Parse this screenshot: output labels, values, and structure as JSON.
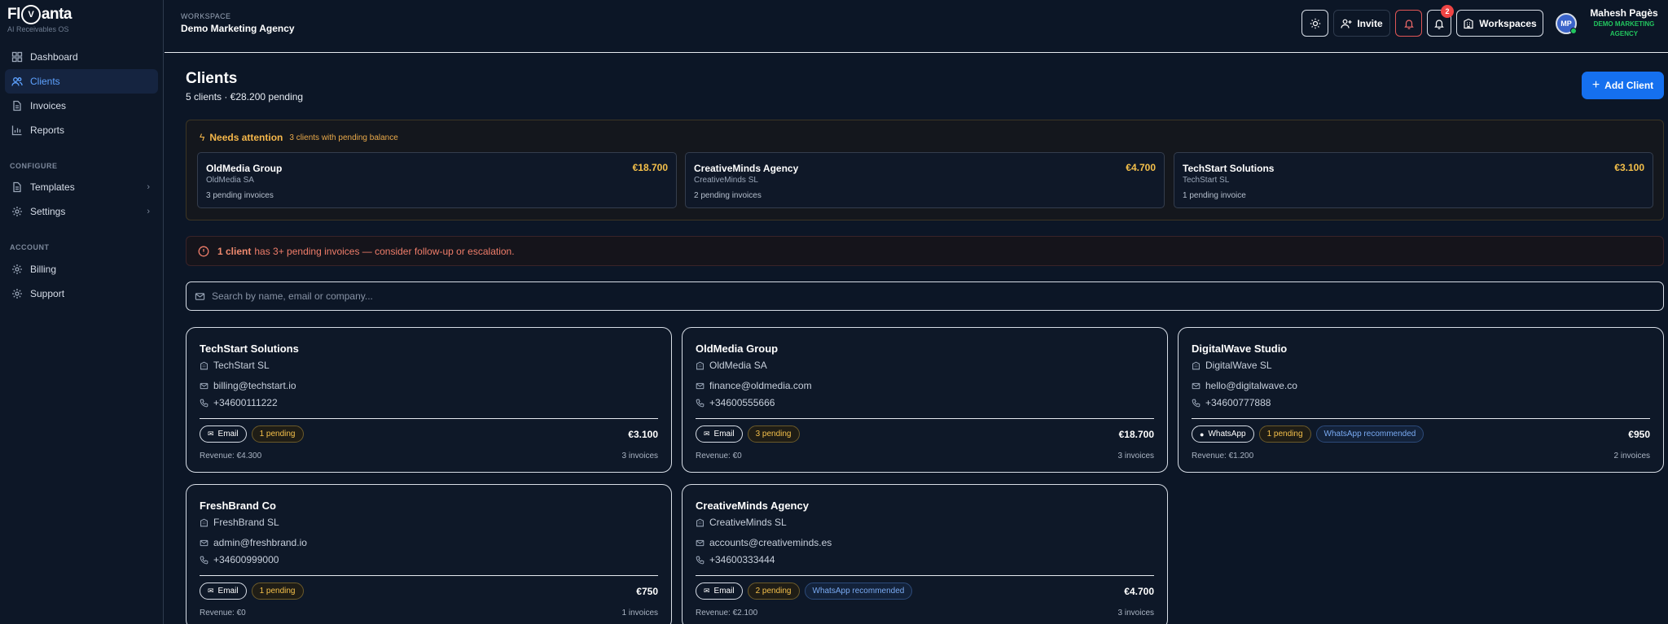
{
  "app": {
    "logo_left": "Fl",
    "logo_badge": "V",
    "logo_right": "anta",
    "subtitle": "AI Receivables OS"
  },
  "sidebar": {
    "main": [
      {
        "label": "Dashboard",
        "icon": "grid-icon",
        "active": false
      },
      {
        "label": "Clients",
        "icon": "users-icon",
        "active": true
      },
      {
        "label": "Invoices",
        "icon": "file-icon",
        "active": false
      },
      {
        "label": "Reports",
        "icon": "chart-icon",
        "active": false
      }
    ],
    "configure_title": "CONFIGURE",
    "configure": [
      {
        "label": "Templates",
        "icon": "file-icon",
        "chevron": "›"
      },
      {
        "label": "Settings",
        "icon": "gear-icon",
        "chevron": "›"
      }
    ],
    "account_title": "ACCOUNT",
    "account": [
      {
        "label": "Billing",
        "icon": "gear-icon"
      },
      {
        "label": "Support",
        "icon": "gear-icon"
      }
    ]
  },
  "header": {
    "workspace_label": "WORKSPACE",
    "workspace_name": "Demo Marketing Agency",
    "invite_label": "Invite",
    "notification_count": "2",
    "workspaces_label": "Workspaces",
    "user_initials": "MP",
    "user_name": "Mahesh Pagès",
    "user_workspace": "DEMO MARKETING AGENCY"
  },
  "page": {
    "title": "Clients",
    "subtitle": "5 clients · €28.200 pending",
    "add_button": "Add Client",
    "add_icon": "+"
  },
  "attention": {
    "title": "Needs attention",
    "subtitle": "3 clients with pending balance",
    "bolt_icon": "ϟ",
    "items": [
      {
        "name": "OldMedia Group",
        "amount": "€18.700",
        "company": "OldMedia SA",
        "pending": "3 pending invoices"
      },
      {
        "name": "CreativeMinds Agency",
        "amount": "€4.700",
        "company": "CreativeMinds SL",
        "pending": "2 pending invoices"
      },
      {
        "name": "TechStart Solutions",
        "amount": "€3.100",
        "company": "TechStart SL",
        "pending": "1 pending invoice"
      }
    ]
  },
  "alert": {
    "strong": "1 client",
    "text": "has 3+ pending invoices — consider follow-up or escalation."
  },
  "search": {
    "placeholder": "Search by name, email or company..."
  },
  "clients": [
    {
      "name": "TechStart Solutions",
      "company": "TechStart SL",
      "email": "billing@techstart.io",
      "phone": "+34600111222",
      "channel": "Email",
      "channel_icon": "✉",
      "pending": "1 pending",
      "recommendation": "",
      "amount": "€3.100",
      "revenue": "Revenue: €4.300",
      "invoices": "3 invoices"
    },
    {
      "name": "OldMedia Group",
      "company": "OldMedia SA",
      "email": "finance@oldmedia.com",
      "phone": "+34600555666",
      "channel": "Email",
      "channel_icon": "✉",
      "pending": "3 pending",
      "recommendation": "",
      "amount": "€18.700",
      "revenue": "Revenue: €0",
      "invoices": "3 invoices"
    },
    {
      "name": "DigitalWave Studio",
      "company": "DigitalWave SL",
      "email": "hello@digitalwave.co",
      "phone": "+34600777888",
      "channel": "WhatsApp",
      "channel_icon": "●",
      "pending": "1 pending",
      "recommendation": "WhatsApp recommended",
      "amount": "€950",
      "revenue": "Revenue: €1.200",
      "invoices": "2 invoices"
    },
    {
      "name": "FreshBrand Co",
      "company": "FreshBrand SL",
      "email": "admin@freshbrand.io",
      "phone": "+34600999000",
      "channel": "Email",
      "channel_icon": "✉",
      "pending": "1 pending",
      "recommendation": "",
      "amount": "€750",
      "revenue": "Revenue: €0",
      "invoices": "1 invoices"
    },
    {
      "name": "CreativeMinds Agency",
      "company": "CreativeMinds SL",
      "email": "accounts@creativeminds.es",
      "phone": "+34600333444",
      "channel": "Email",
      "channel_icon": "✉",
      "pending": "2 pending",
      "recommendation": "WhatsApp recommended",
      "amount": "€4.700",
      "revenue": "Revenue: €2.100",
      "invoices": "3 invoices"
    }
  ],
  "colors": {
    "accent": "#1570ef",
    "pending": "#f5c04a",
    "success": "#22c55e",
    "danger": "#ef4444"
  }
}
